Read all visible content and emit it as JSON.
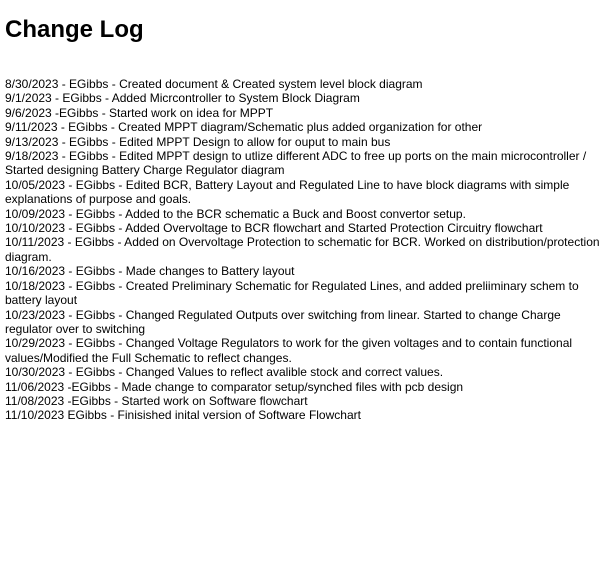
{
  "title": "Change Log",
  "entries": [
    "8/30/2023 - EGibbs - Created document & Created system level block diagram",
    "9/1/2023 - EGibbs - Added Micrcontroller to System Block Diagram",
    "9/6/2023 -EGibbs - Started work on idea for MPPT",
    "9/11/2023 - EGibbs - Created MPPT diagram/Schematic plus added organization for other",
    "9/13/2023 - EGibbs - Edited MPPT Design to allow for ouput to main bus",
    "9/18/2023 - EGibbs - Edited MPPT design to utlize different ADC to free up ports on the main microcontroller / Started designing Battery Charge Regulator diagram",
    "10/05/2023 - EGibbs - Edited BCR, Battery Layout and Regulated Line to have block diagrams with simple explanations of purpose and goals.",
    "10/09/2023 - EGibbs - Added to the BCR schematic a Buck and Boost convertor setup.",
    "10/10/2023 - EGibbs - Added Overvoltage to BCR flowchart and Started Protection Circuitry flowchart",
    "10/11/2023 - EGibbs - Added on Overvoltage Protection to schematic for BCR. Worked on distribution/protection diagram.",
    "10/16/2023 - EGibbs - Made changes to Battery layout",
    "10/18/2023 - EGibbs - Created Preliminary Schematic for Regulated Lines, and added preliiminary schem to battery layout",
    "10/23/2023 - EGibbs - Changed Regulated Outputs over switching from linear. Started to change Charge regulator over to switching",
    "10/29/2023 - EGibbs - Changed Voltage Regulators to work for the given voltages and to contain functional values/Modified the Full Schematic to reflect changes.",
    "10/30/2023 - EGibbs - Changed Values to reflect avalible stock and correct values.",
    "11/06/2023 -EGibbs - Made change to comparator setup/synched files with pcb design",
    "11/08/2023 -EGibbs - Started work on Software flowchart",
    "11/10/2023 EGibbs - Finisished inital version of Software Flowchart"
  ]
}
